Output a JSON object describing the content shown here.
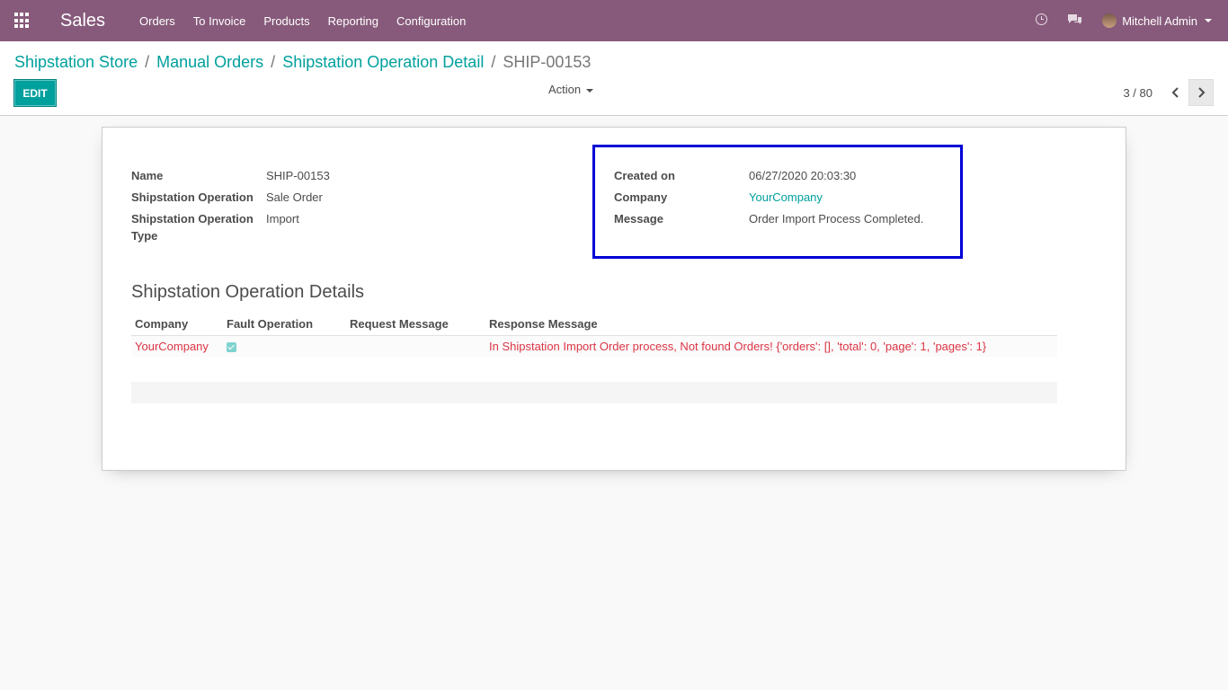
{
  "navbar": {
    "app_name": "Sales",
    "menu": [
      "Orders",
      "To Invoice",
      "Products",
      "Reporting",
      "Configuration"
    ],
    "icons": [
      "apps-grid-icon",
      "clock-icon",
      "chat-icon"
    ],
    "user_name": "Mitchell Admin",
    "background_color": "#875a7b"
  },
  "breadcrumb": {
    "items": [
      "Shipstation Store",
      "Manual Orders",
      "Shipstation Operation Detail"
    ],
    "current": "SHIP-00153",
    "separator": "/"
  },
  "toolbar": {
    "edit_label": "EDIT",
    "action_label": "Action",
    "pager_value": "3 / 80",
    "accent_color": "#00a09d"
  },
  "form": {
    "left_fields": [
      {
        "label": "Name",
        "value": "SHIP-00153"
      },
      {
        "label": "Shipstation Operation",
        "value": "Sale Order"
      },
      {
        "label": "Shipstation Operation Type",
        "value": "Import"
      }
    ],
    "right_fields": [
      {
        "label": "Created on",
        "value": "06/27/2020 20:03:30"
      },
      {
        "label": "Company",
        "value": "YourCompany"
      },
      {
        "label": "Message",
        "value": "Order Import Process Completed."
      }
    ],
    "highlight_color": "#0000d6"
  },
  "details": {
    "title": "Shipstation Operation Details",
    "columns": [
      "Company",
      "Fault Operation",
      "Request Message",
      "Response Message"
    ],
    "rows": [
      {
        "company": "YourCompany",
        "fault_operation": true,
        "request_message": "",
        "response_message": "In Shipstation Import Order process, Not found Orders! {'orders': [], 'total': 0, 'page': 1, 'pages': 1}"
      }
    ],
    "row_text_color": "#dc3545"
  }
}
